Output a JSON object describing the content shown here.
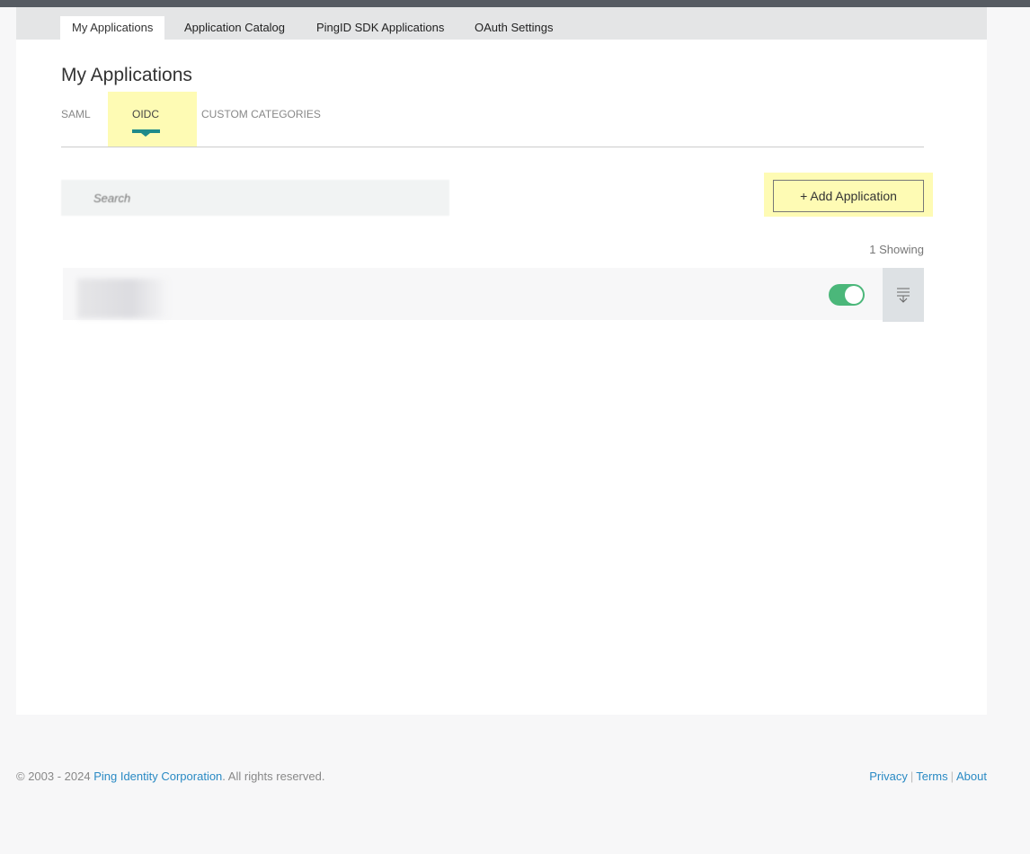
{
  "tabs": [
    {
      "label": "My Applications",
      "active": true
    },
    {
      "label": "Application Catalog"
    },
    {
      "label": "PingID SDK Applications"
    },
    {
      "label": "OAuth Settings"
    }
  ],
  "page_title": "My Applications",
  "subtabs": [
    {
      "label": "SAML"
    },
    {
      "label": "OIDC",
      "active": true
    },
    {
      "label": "CUSTOM CATEGORIES"
    }
  ],
  "search": {
    "placeholder": "Search",
    "value": ""
  },
  "add_button": {
    "icon": "plus-icon",
    "label": "+ Add Application"
  },
  "showing": "1 Showing",
  "applications": [
    {
      "enabled": true
    }
  ],
  "footer": {
    "copyright": "© 2003 - 2024 ",
    "company": "Ping Identity Corporation",
    "rights": ". All rights reserved.",
    "links": [
      "Privacy",
      "Terms",
      "About"
    ]
  },
  "colors": {
    "accent": "#1f8a8a",
    "toggle_on": "#4bb77a",
    "link": "#2a8ac4",
    "highlight": "#fefbb4"
  }
}
